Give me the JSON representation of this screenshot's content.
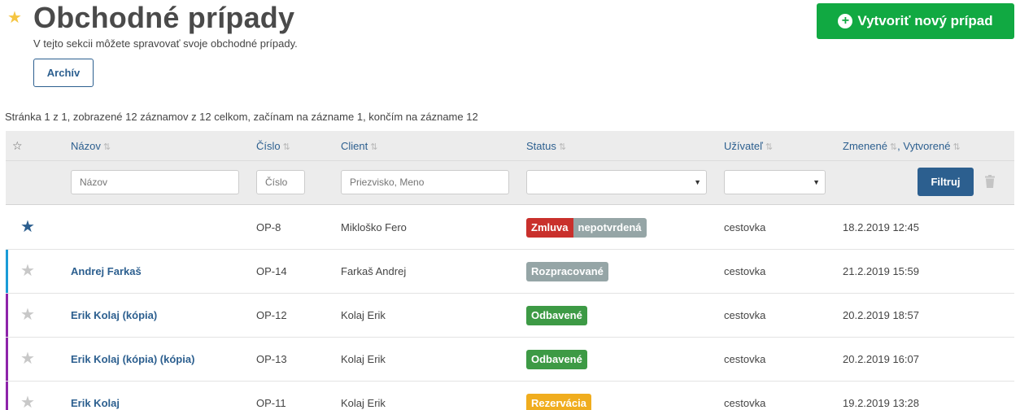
{
  "header": {
    "title": "Obchodné prípady",
    "subtitle": "V tejto sekcii môžete spravovať svoje obchodné prípady.",
    "archive_label": "Archív",
    "create_label": "Vytvoriť nový prípad",
    "favorite_icon": "star-icon"
  },
  "paging": {
    "text": "Stránka 1 z 1, zobrazené 12 záznamov z 12 celkom, začínam na zázname 1, končím na zázname 12"
  },
  "table": {
    "columns": {
      "name": "Názov",
      "number": "Číslo",
      "client": "Client",
      "status": "Status",
      "user": "Užívateľ",
      "changed": "Zmenené",
      "created": "Vytvorené"
    },
    "filters": {
      "name_placeholder": "Názov",
      "number_placeholder": "Číslo",
      "client_placeholder": "Priezvisko, Meno",
      "status_value": "",
      "user_value": "",
      "filter_label": "Filtruj"
    },
    "rows": [
      {
        "favorite": true,
        "bar_color": "",
        "name": "",
        "number": "OP-8",
        "client": "Mikloško Fero",
        "badges": [
          {
            "label": "Zmluva",
            "color": "#c9302c"
          },
          {
            "label": "nepotvrdená",
            "color": "#95a5a6"
          }
        ],
        "user": "cestovka",
        "date": "18.2.2019 12:45"
      },
      {
        "favorite": false,
        "bar_color": "#1a9bd7",
        "name": "Andrej Farkaš",
        "number": "OP-14",
        "client": "Farkaš Andrej",
        "badges": [
          {
            "label": "Rozpracované",
            "color": "#95a5a6"
          }
        ],
        "user": "cestovka",
        "date": "21.2.2019 15:59"
      },
      {
        "favorite": false,
        "bar_color": "#8e24aa",
        "name": "Erik Kolaj (kópia)",
        "number": "OP-12",
        "client": "Kolaj Erik",
        "badges": [
          {
            "label": "Odbavené",
            "color": "#3d9a45"
          }
        ],
        "user": "cestovka",
        "date": "20.2.2019 18:57"
      },
      {
        "favorite": false,
        "bar_color": "#8e24aa",
        "name": "Erik Kolaj (kópia) (kópia)",
        "number": "OP-13",
        "client": "Kolaj Erik",
        "badges": [
          {
            "label": "Odbavené",
            "color": "#3d9a45"
          }
        ],
        "user": "cestovka",
        "date": "20.2.2019 16:07"
      },
      {
        "favorite": false,
        "bar_color": "#8e24aa",
        "name": "Erik Kolaj",
        "number": "OP-11",
        "client": "Kolaj Erik",
        "badges": [
          {
            "label": "Rezervácia",
            "color": "#f0ad1e"
          }
        ],
        "user": "cestovka",
        "date": "19.2.2019 13:28"
      }
    ]
  },
  "colors": {
    "accent": "#2c5f8f",
    "create_button": "#11a942",
    "header_bg": "#ececec"
  }
}
